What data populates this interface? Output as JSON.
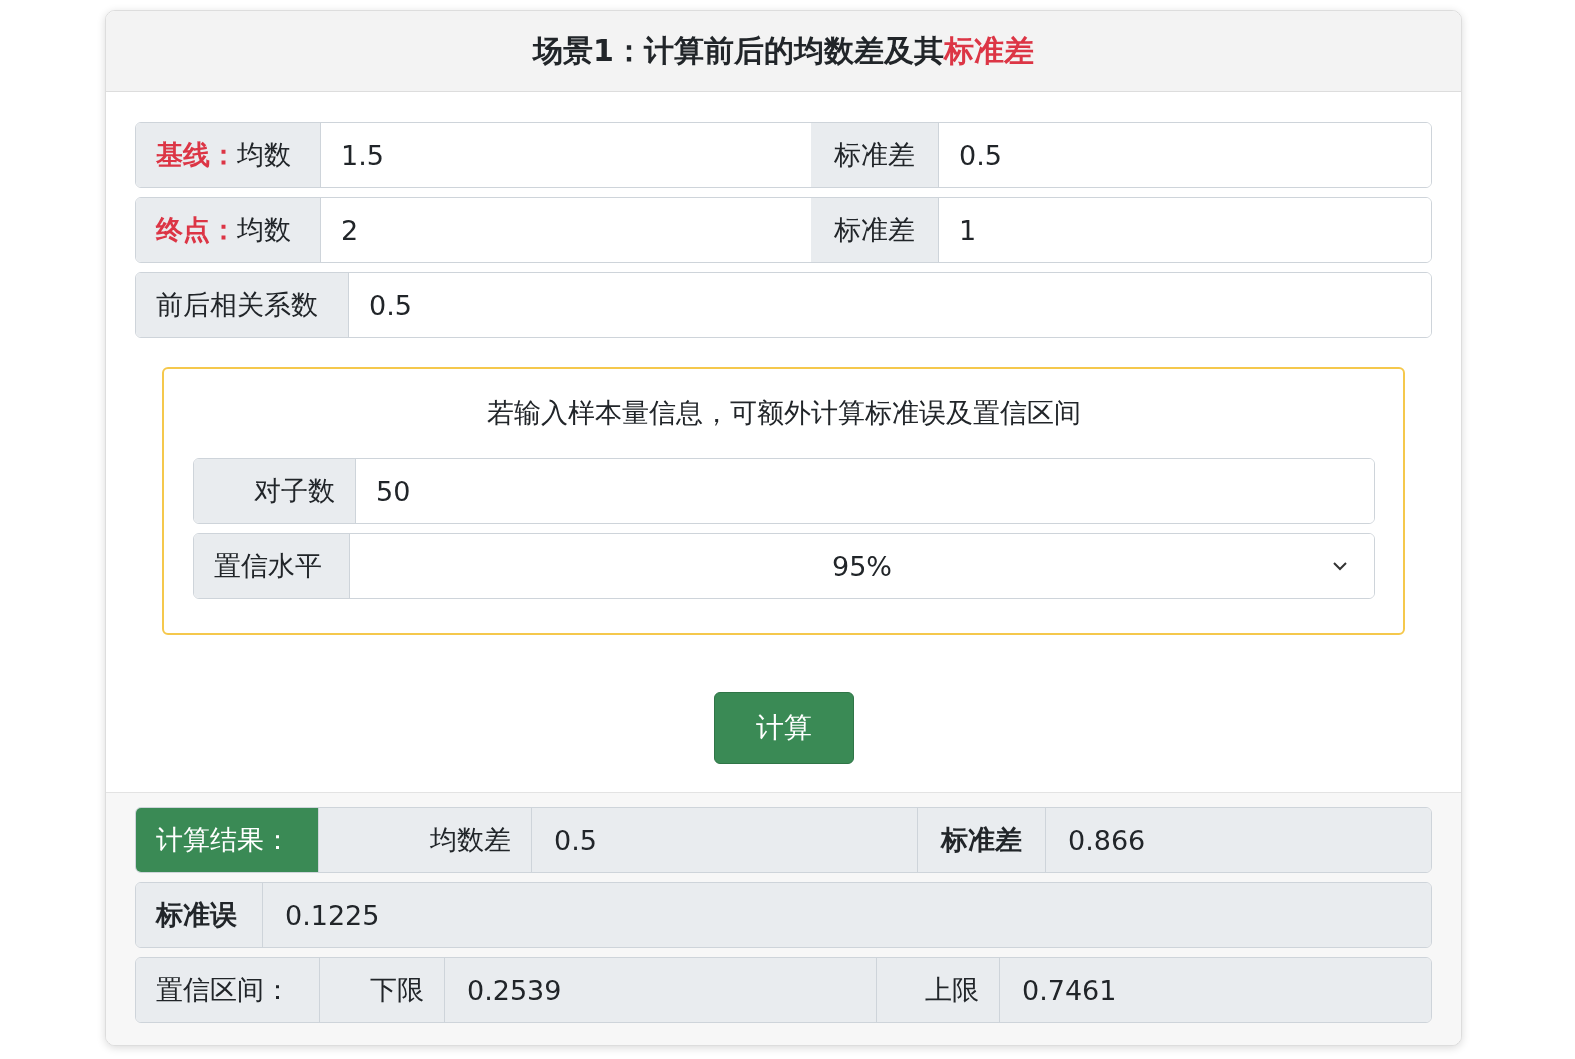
{
  "title": {
    "main": "场景1：计算前后的均数差及其",
    "highlight": "标准差"
  },
  "measures": [
    {
      "tag": "基线：",
      "mean_label": "均数",
      "mean_value": "1.5",
      "sd_label": "标准差",
      "sd_value": "0.5"
    },
    {
      "tag": "终点：",
      "mean_label": "均数",
      "mean_value": "2",
      "sd_label": "标准差",
      "sd_value": "1"
    }
  ],
  "correlation": {
    "label": "前后相关系数",
    "value": "0.5"
  },
  "sample_box": {
    "note": "若输入样本量信息，可额外计算标准误及置信区间",
    "pairs": {
      "label": "对子数",
      "value": "50"
    },
    "confidence": {
      "label": "置信水平",
      "value": "95%"
    }
  },
  "calculate_button": "计算",
  "results": {
    "heading": "计算结果：",
    "mean_diff_label": "均数差",
    "mean_diff": "0.5",
    "sd_label": "标准差",
    "sd": "0.866",
    "se_label": "标准误",
    "se": "0.1225",
    "ci_label": "置信区间：",
    "lower_label": "下限",
    "lower": "0.2539",
    "upper_label": "上限",
    "upper": "0.7461"
  }
}
